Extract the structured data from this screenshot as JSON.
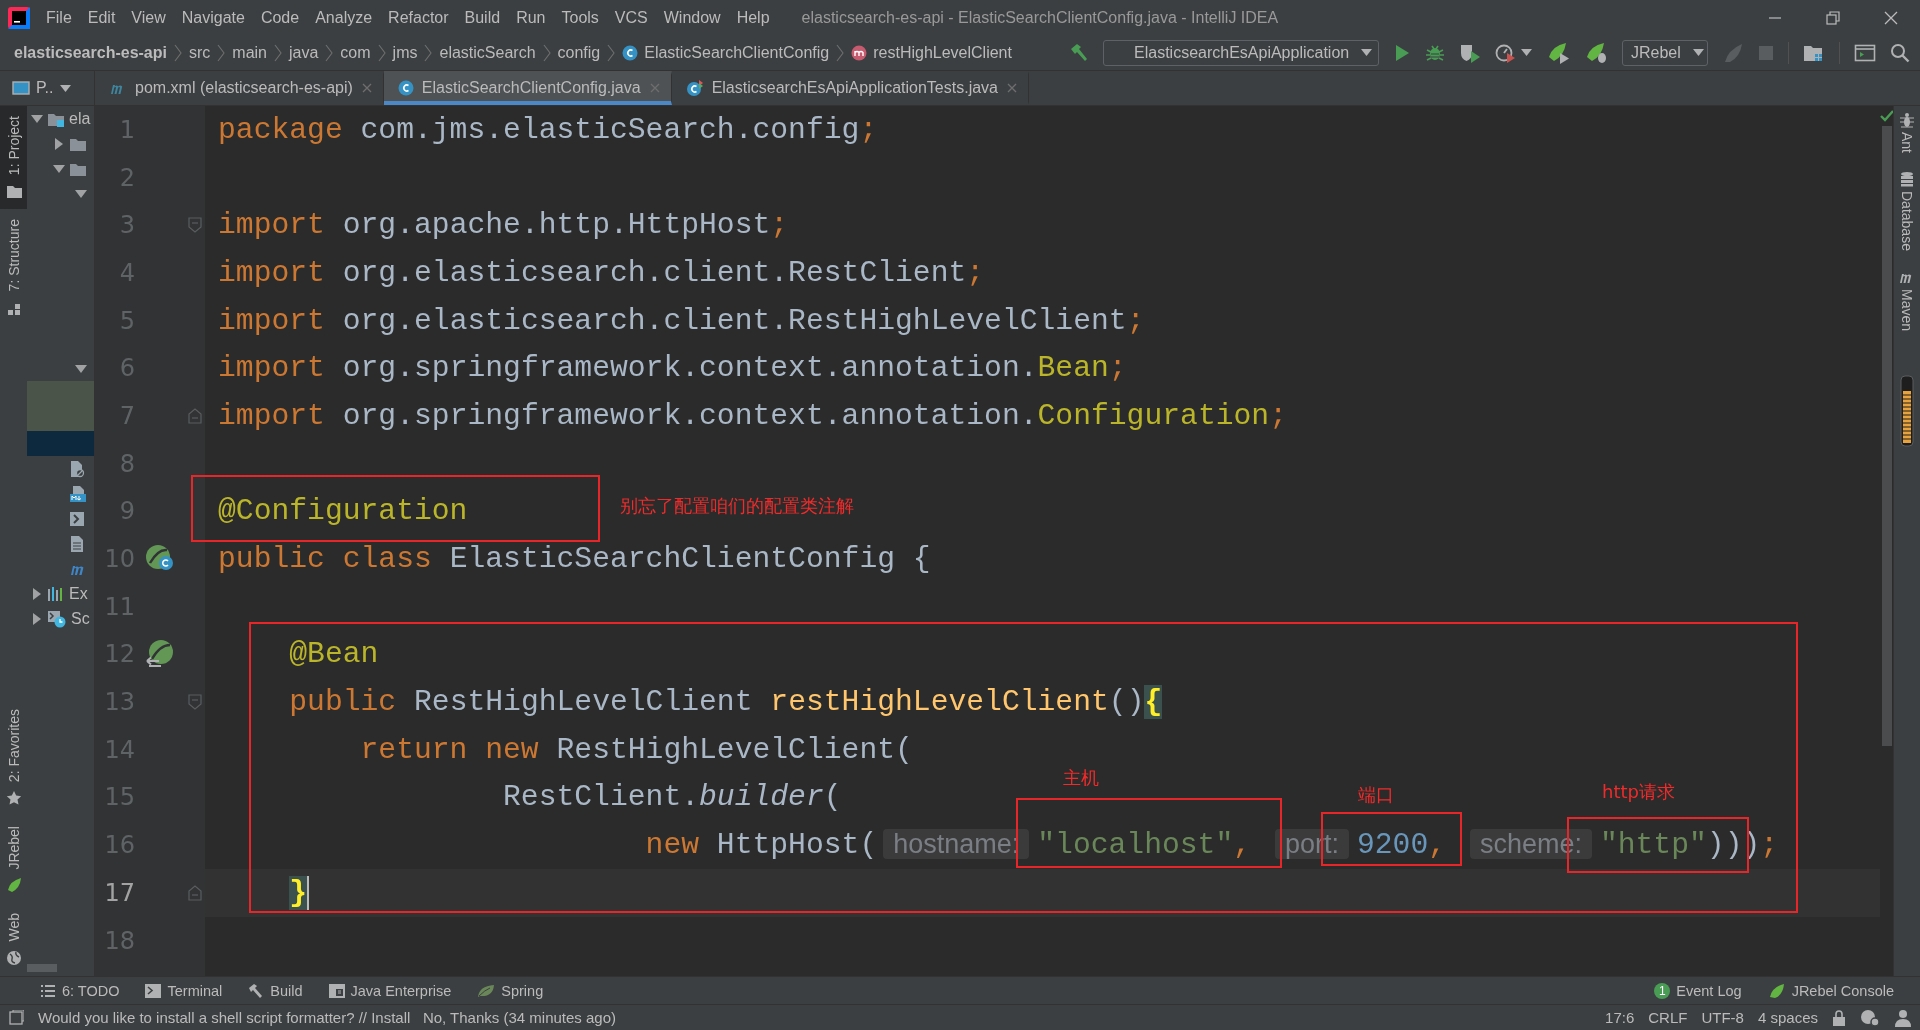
{
  "window": {
    "title": "elasticsearch-es-api - ElasticSearchClientConfig.java - IntelliJ IDEA"
  },
  "menu": [
    "File",
    "Edit",
    "View",
    "Navigate",
    "Code",
    "Analyze",
    "Refactor",
    "Build",
    "Run",
    "Tools",
    "VCS",
    "Window",
    "Help"
  ],
  "breadcrumbs": [
    {
      "label": "elasticsearch-es-api",
      "kind": "project"
    },
    {
      "label": "src",
      "kind": "folder"
    },
    {
      "label": "main",
      "kind": "folder"
    },
    {
      "label": "java",
      "kind": "folder"
    },
    {
      "label": "com",
      "kind": "folder"
    },
    {
      "label": "jms",
      "kind": "folder"
    },
    {
      "label": "elasticSearch",
      "kind": "folder"
    },
    {
      "label": "config",
      "kind": "folder"
    },
    {
      "label": "ElasticSearchClientConfig",
      "kind": "class"
    },
    {
      "label": "restHighLevelClient",
      "kind": "method"
    }
  ],
  "toolbar": {
    "run_configuration": "ElasticsearchEsApiApplication",
    "jrebel_mode": "JRebel"
  },
  "tool_stripes": {
    "left_top": [
      {
        "label": "1: Project",
        "kind": "project",
        "selected": true
      },
      {
        "label": "7: Structure",
        "kind": "structure",
        "selected": false
      }
    ],
    "left_bottom": [
      {
        "label": "2: Favorites",
        "kind": "favorites",
        "selected": false
      },
      {
        "label": "JRebel",
        "kind": "jrebel",
        "selected": false
      },
      {
        "label": "Web",
        "kind": "web",
        "selected": false
      }
    ],
    "right": [
      {
        "label": "Ant",
        "kind": "ant"
      },
      {
        "label": "Database",
        "kind": "database"
      },
      {
        "label": "Maven",
        "kind": "maven"
      }
    ]
  },
  "project_panel": {
    "tab": "P..",
    "tree": [
      {
        "label": "ela",
        "kind": "module",
        "expanded": true,
        "children": [
          {
            "kind": "folder",
            "expanded": false
          },
          {
            "kind": "folder",
            "expanded": true,
            "children": [
              {
                "kind": "node",
                "expanded": true,
                "children": [
                  {
                    "kind": "row",
                    "selected": false,
                    "marked": false
                  },
                  {
                    "kind": "row",
                    "selected": false,
                    "marked": false
                  },
                  {
                    "kind": "row",
                    "selected": false,
                    "marked": false
                  },
                  {
                    "kind": "row",
                    "selected": false,
                    "marked": false
                  },
                  {
                    "kind": "row",
                    "selected": false,
                    "marked": false
                  },
                  {
                    "kind": "row",
                    "selected": false,
                    "marked": false
                  }
                ]
              },
              {
                "kind": "node",
                "expanded": true,
                "children": [
                  {
                    "kind": "row",
                    "selected": false,
                    "marked": true
                  },
                  {
                    "kind": "row",
                    "selected": false,
                    "marked": true
                  },
                  {
                    "kind": "row",
                    "selected": true,
                    "marked": false
                  }
                ]
              }
            ]
          },
          {
            "kind": "ignore-file"
          },
          {
            "kind": "markdown-file"
          },
          {
            "kind": "script-file"
          },
          {
            "kind": "text-file"
          },
          {
            "kind": "maven-file"
          }
        ]
      },
      {
        "label": "Ex",
        "kind": "libraries",
        "expanded": false
      },
      {
        "label": "Sc",
        "kind": "scratches",
        "expanded": false
      }
    ]
  },
  "editor_tabs": [
    {
      "label": "pom.xml (elasticsearch-es-api)",
      "kind": "maven",
      "selected": false
    },
    {
      "label": "ElasticSearchClientConfig.java",
      "kind": "class",
      "selected": true
    },
    {
      "label": "ElasticsearchEsApiApplicationTests.java",
      "kind": "test-class",
      "selected": false
    }
  ],
  "editor": {
    "lines": [
      {
        "number": "1",
        "current": false,
        "tokens": [
          {
            "text": "package",
            "kind": "keyword"
          },
          {
            "text": " com.jms.elasticSearch.config",
            "kind": "plain"
          },
          {
            "text": ";",
            "kind": "keyword"
          }
        ]
      },
      {
        "number": "2",
        "current": false
      },
      {
        "number": "3",
        "current": false,
        "fold": {
          "kind": "start"
        },
        "tokens": [
          {
            "text": "import",
            "kind": "keyword"
          },
          {
            "text": " org.apache.http.HttpHost",
            "kind": "plain"
          },
          {
            "text": ";",
            "kind": "keyword"
          }
        ]
      },
      {
        "number": "4",
        "current": false,
        "tokens": [
          {
            "text": "import",
            "kind": "keyword"
          },
          {
            "text": " org.elasticsearch.client.RestClient",
            "kind": "plain"
          },
          {
            "text": ";",
            "kind": "keyword"
          }
        ]
      },
      {
        "number": "5",
        "current": false,
        "tokens": [
          {
            "text": "import",
            "kind": "keyword"
          },
          {
            "text": " org.elasticsearch.client.RestHighLevelClient",
            "kind": "plain"
          },
          {
            "text": ";",
            "kind": "keyword"
          }
        ]
      },
      {
        "number": "6",
        "current": false,
        "tokens": [
          {
            "text": "import",
            "kind": "keyword"
          },
          {
            "text": " org.springframework.context.annotation.",
            "kind": "plain"
          },
          {
            "text": "Bean",
            "kind": "annotation"
          },
          {
            "text": ";",
            "kind": "keyword"
          }
        ]
      },
      {
        "number": "7",
        "current": false,
        "fold": {
          "kind": "end"
        },
        "tokens": [
          {
            "text": "import",
            "kind": "keyword"
          },
          {
            "text": " org.springframework.context.annotation.",
            "kind": "plain"
          },
          {
            "text": "Configuration",
            "kind": "annotation"
          },
          {
            "text": ";",
            "kind": "keyword"
          }
        ]
      },
      {
        "number": "8",
        "current": false
      },
      {
        "number": "9",
        "current": false,
        "tokens": [
          {
            "text": "@Configuration",
            "kind": "annotation"
          }
        ]
      },
      {
        "number": "10",
        "current": false,
        "gutter": {
          "kind": "class-bean"
        },
        "tokens": [
          {
            "text": "public class",
            "kind": "keyword"
          },
          {
            "text": " ElasticSearchClientConfig {",
            "kind": "plain"
          }
        ]
      },
      {
        "number": "11",
        "current": false
      },
      {
        "number": "12",
        "current": false,
        "gutter": {
          "kind": "method-bean"
        },
        "tokens": [
          {
            "text": "    @Bean",
            "kind": "annotation"
          }
        ]
      },
      {
        "number": "13",
        "current": false,
        "fold": {
          "kind": "start"
        },
        "tokens": [
          {
            "text": "    public",
            "kind": "keyword"
          },
          {
            "text": " RestHighLevelClient ",
            "kind": "plain"
          },
          {
            "text": "restHighLevelClient",
            "kind": "method"
          },
          {
            "text": "()",
            "kind": "plain"
          },
          {
            "text": "{",
            "kind": "brace"
          }
        ]
      },
      {
        "number": "14",
        "current": false,
        "tokens": [
          {
            "text": "        return new",
            "kind": "keyword"
          },
          {
            "text": " RestHighLevelClient(",
            "kind": "plain"
          }
        ]
      },
      {
        "number": "15",
        "current": false,
        "tokens": [
          {
            "text": "                RestClient.",
            "kind": "plain"
          },
          {
            "text": "builder",
            "kind": "static"
          },
          {
            "text": "(",
            "kind": "plain"
          }
        ]
      },
      {
        "number": "16",
        "current": false,
        "tokens": [
          {
            "text": "                        new",
            "kind": "keyword"
          },
          {
            "text": " HttpHost(",
            "kind": "plain"
          },
          {
            "text": "hostname:",
            "kind": "hint"
          },
          {
            "text": "\"localhost\"",
            "kind": "string"
          },
          {
            "text": ", ",
            "kind": "keyword"
          },
          {
            "text": "port:",
            "kind": "hint"
          },
          {
            "text": "9200",
            "kind": "number"
          },
          {
            "text": ", ",
            "kind": "keyword"
          },
          {
            "text": "scheme:",
            "kind": "hint"
          },
          {
            "text": "\"http\"",
            "kind": "string"
          },
          {
            "text": ")))",
            "kind": "plain"
          },
          {
            "text": ";",
            "kind": "keyword"
          }
        ]
      },
      {
        "number": "17",
        "current": true,
        "fold": {
          "kind": "end"
        },
        "tokens": [
          {
            "text": "    }",
            "kind": "brace"
          }
        ]
      },
      {
        "number": "18",
        "current": false
      }
    ]
  },
  "annotations": [
    {
      "text": "别忘了配置咱们的配置类注解"
    },
    {
      "text": "主机"
    },
    {
      "text": "端口"
    },
    {
      "text": "http请求"
    }
  ],
  "bottom_tools": {
    "left": [
      {
        "label": "6: TODO",
        "kind": "todo"
      },
      {
        "label": "Terminal",
        "kind": "terminal"
      },
      {
        "label": "Build",
        "kind": "build"
      },
      {
        "label": "Java Enterprise",
        "kind": "enterprise"
      },
      {
        "label": "Spring",
        "kind": "spring"
      }
    ],
    "right": [
      {
        "label": "Event Log",
        "kind": "event-log",
        "badge": "1"
      },
      {
        "label": "JRebel Console",
        "kind": "jrebel"
      }
    ]
  },
  "status_bar": {
    "message": "Would you like to install a shell script formatter? // Install   No, Thanks (34 minutes ago)",
    "position": "17:6",
    "line_separator": "CRLF",
    "encoding": "UTF-8",
    "indent": "4 spaces"
  }
}
